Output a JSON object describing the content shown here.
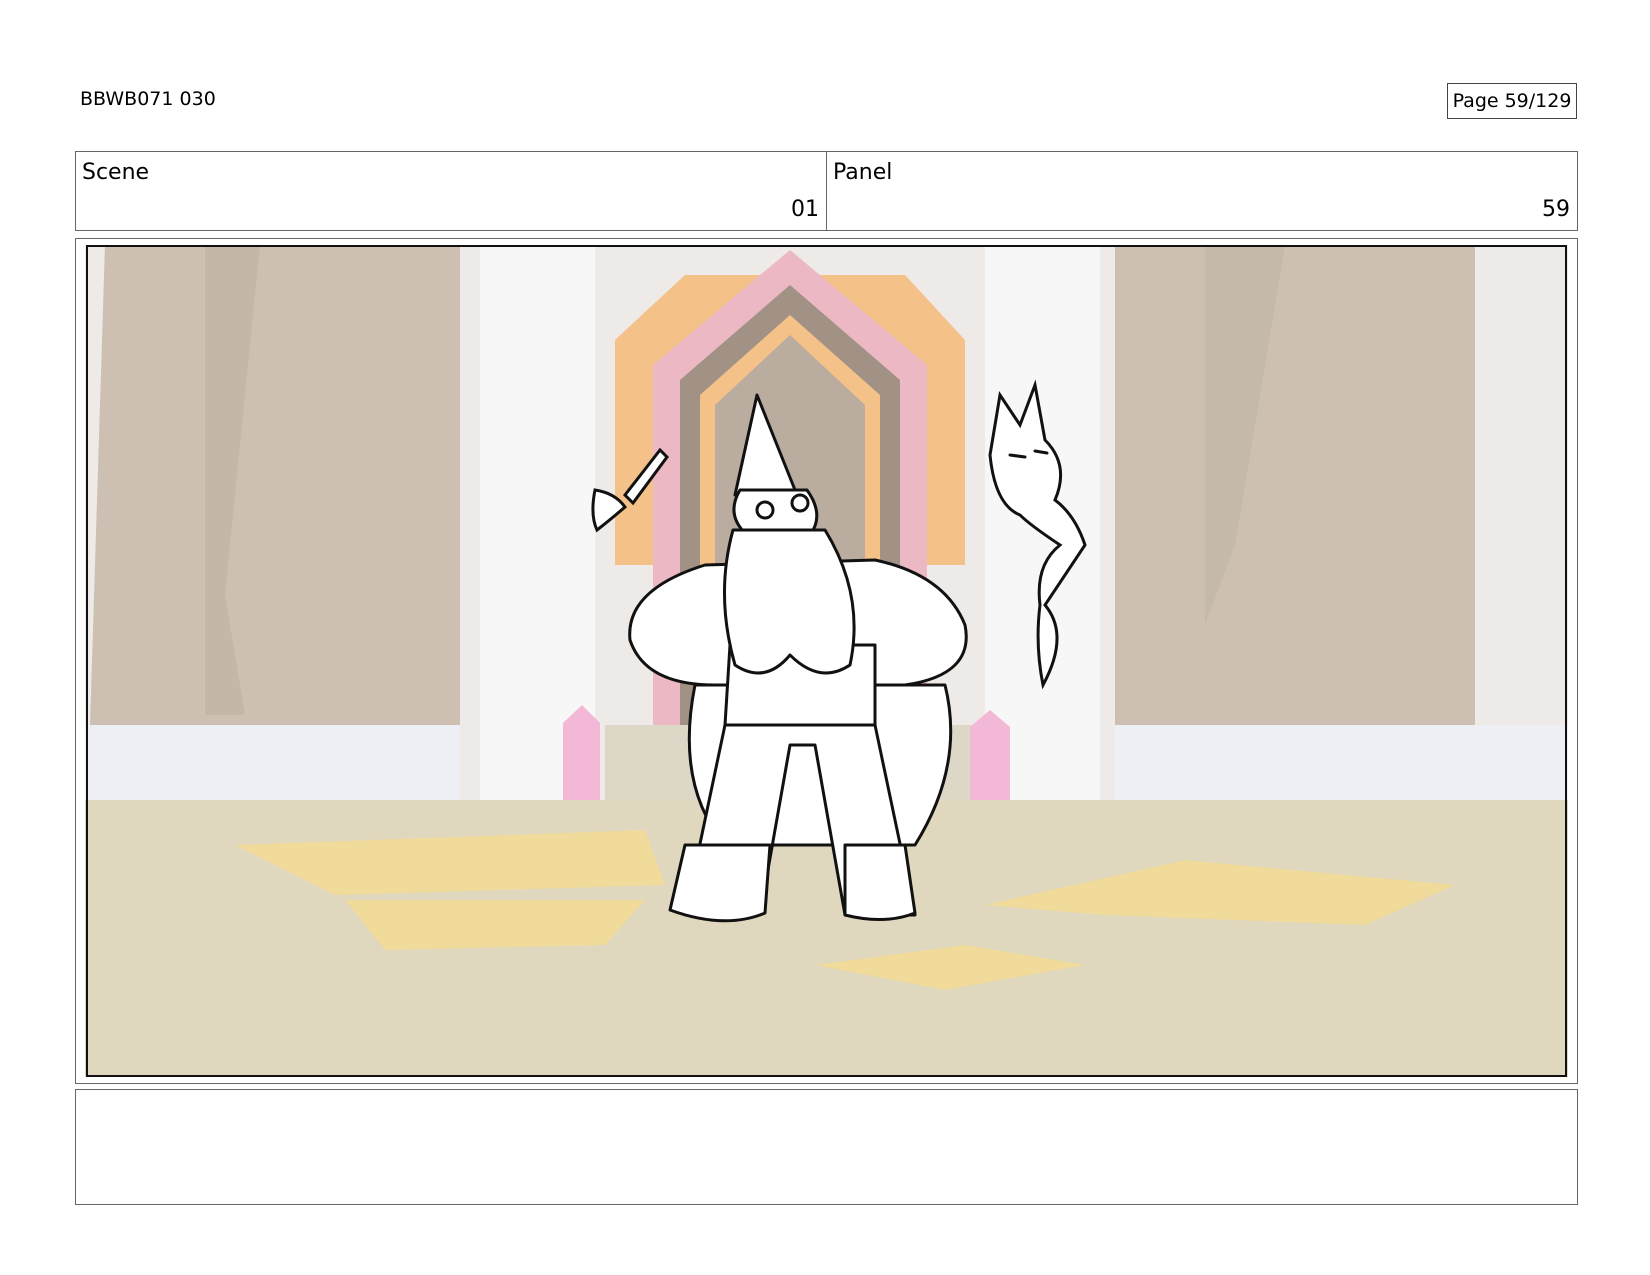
{
  "header": {
    "production_code": "BBWB071 030",
    "page_label": "Page",
    "page_value": "59/129"
  },
  "scene": {
    "label": "Scene",
    "value": "01"
  },
  "panel": {
    "label": "Panel",
    "value": "59"
  },
  "notes": {
    "text": ""
  },
  "colors": {
    "pillar": "#c2b3a2",
    "floor": "#d8cfb0",
    "floor_highlight": "#f2d37a",
    "door_pink": "#e7a9b6",
    "door_orange": "#f2b46e",
    "door_dark": "#8e7a6c",
    "crystal_pink": "#f0a9cc",
    "ink": "#111111"
  }
}
